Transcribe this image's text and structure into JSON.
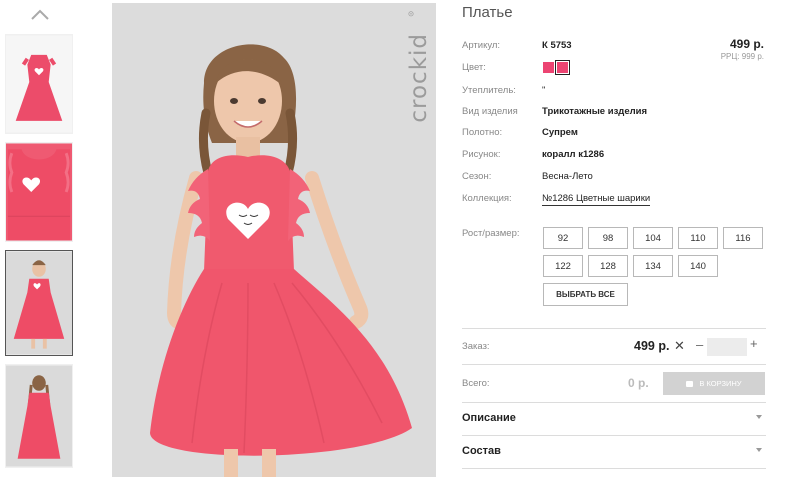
{
  "product": {
    "title": "Платье",
    "price": "499 р.",
    "rrp": "РРЦ: 999 р.",
    "colors": [
      "#ec4472",
      "#ec4472"
    ],
    "brand_watermark": "crockid"
  },
  "specs": [
    {
      "label": "Артикул:",
      "value": "К 5753"
    },
    {
      "label": "Цвет:",
      "value": ""
    },
    {
      "label": "Утеплитель:",
      "value": "\""
    },
    {
      "label": "Вид изделия",
      "value": "Трикотажные изделия"
    },
    {
      "label": "Полотно:",
      "value": "Супрем"
    },
    {
      "label": "Рисунок:",
      "value": "коралл к1286"
    },
    {
      "label": "Сезон:",
      "value": "Весна-Лето"
    },
    {
      "label": "Коллекция:",
      "value": "№1286 Цветные шарики"
    }
  ],
  "sizes": {
    "label": "Рост/размер:",
    "options": [
      "92",
      "98",
      "104",
      "110",
      "116",
      "122",
      "128",
      "134",
      "140"
    ],
    "select_all": "ВЫБРАТЬ ВСЕ"
  },
  "order": {
    "label": "Заказ:",
    "price": "499 р.",
    "x_mark": "✕",
    "minus": "–",
    "plus": "+",
    "quantity": ""
  },
  "total": {
    "label": "Всего:",
    "value": "0 р.",
    "cart_button": "В КОРЗИНУ"
  },
  "accordions": [
    "Описание",
    "Состав"
  ],
  "thumbnails": {
    "active_index": 2,
    "count": 4
  }
}
